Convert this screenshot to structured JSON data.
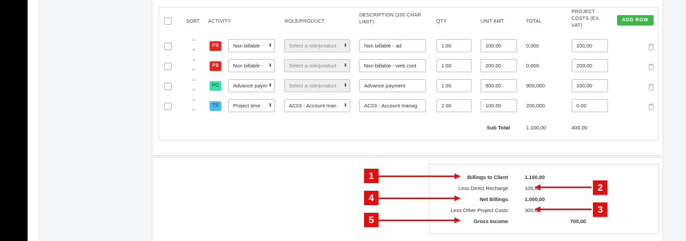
{
  "table": {
    "headers": {
      "sort": "SORT",
      "activity": "ACTIVITY",
      "role": "ROLE/PRODUCT",
      "description": "DESCRIPTION (200 CHAR LIMIT)",
      "qty": "QTY",
      "unit_amt": "UNIT AMT",
      "total": "TOTAL",
      "project_costs": "PROJECT COSTS (EX. VAT)"
    },
    "add_row_label": "ADD ROW",
    "rows": [
      {
        "badge": "PB",
        "badge_bg": "#e02a1f",
        "badge_fg": "#ffffff",
        "activity": "Non billable - ",
        "role": "Select a role/product",
        "description": "Non billable - ad",
        "qty": "1.00",
        "unit_amt": "100.00",
        "total": "0,000",
        "project_costs": "100,00"
      },
      {
        "badge": "PB",
        "badge_bg": "#e02a1f",
        "badge_fg": "#ffffff",
        "activity": "Non billable - ",
        "role": "Select a role/product",
        "description": "Non billable - web cont",
        "qty": "1.00",
        "unit_amt": "200.00",
        "total": "0,000",
        "project_costs": "200,00"
      },
      {
        "badge": "PO",
        "badge_bg": "#3fe0a6",
        "badge_fg": "#1a4a3a",
        "activity": "Advance paym",
        "role": "Select a role/product",
        "description": "Advance payment",
        "qty": "1.00",
        "unit_amt": "900.00",
        "total": "900,000",
        "project_costs": "100,00"
      },
      {
        "badge": "TS",
        "badge_bg": "#4cbcf0",
        "badge_fg": "#123a55",
        "activity": "Project time ",
        "role": "AC03 - Account man",
        "description": "AC03 - Account manag",
        "qty": "2.00",
        "unit_amt": "100.00",
        "total": "200,000",
        "project_costs": "0,00"
      }
    ],
    "subtotal": {
      "label": "Sub Total",
      "total": "1.100,00",
      "project_costs": "400,00"
    }
  },
  "summary": {
    "billings_to_client": {
      "label": "Billings to Client",
      "value": "1.100,00"
    },
    "less_direct_recharge": {
      "label": "Less Direct Recharge",
      "value": "100,00"
    },
    "net_billings": {
      "label": "Net Billings",
      "value": "1.000,00"
    },
    "less_other_project_costs": {
      "label": "Less Other Project Costs",
      "value": "300,00"
    },
    "gross_income": {
      "label": "Gross Income",
      "value": "700,00"
    }
  },
  "callouts": [
    "1",
    "2",
    "3",
    "4",
    "5"
  ],
  "colors": {
    "add_row": "#3fb64a",
    "callout": "#e01010"
  },
  "icons": {
    "sort": "sort-updown-icon",
    "dropdown": "updown-caret-icon",
    "delete": "trash-icon"
  }
}
